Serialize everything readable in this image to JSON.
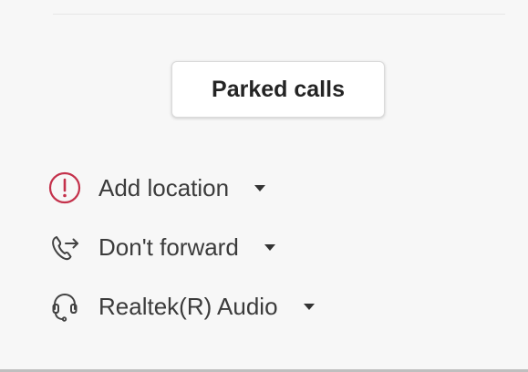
{
  "parked_calls": {
    "label": "Parked calls"
  },
  "settings": [
    {
      "label": "Add location",
      "icon": "alert-circle-icon",
      "icon_color": "#c4314b"
    },
    {
      "label": "Don't forward",
      "icon": "call-forward-icon",
      "icon_color": "#424242"
    },
    {
      "label": "Realtek(R) Audio",
      "icon": "headset-icon",
      "icon_color": "#424242"
    }
  ]
}
